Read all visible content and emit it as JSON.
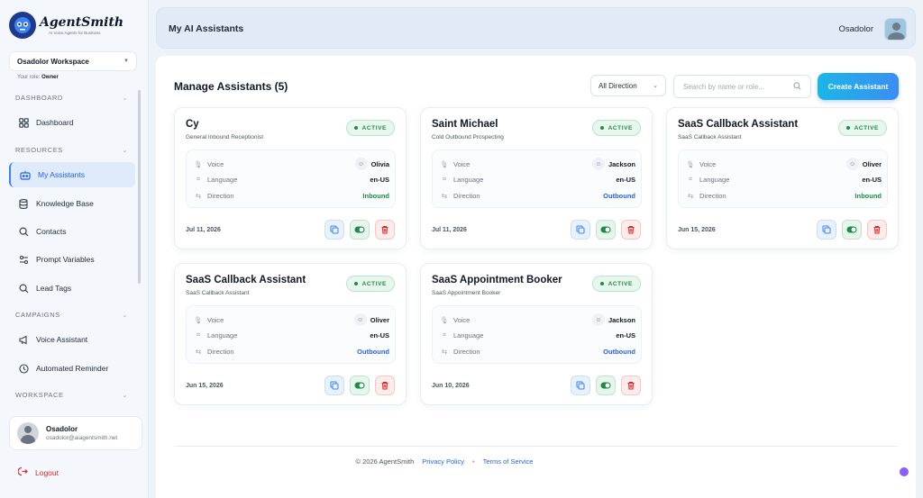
{
  "brand": {
    "name": "AgentSmith",
    "tagline": "AI Voice Agents for Business"
  },
  "sidebar": {
    "workspace": "Osadolor Workspace",
    "role_label": "Your role:",
    "role_value": "Owner",
    "sections": {
      "dashboard": "DASHBOARD",
      "resources": "RESOURCES",
      "campaigns": "CAMPAIGNS",
      "workspace": "WORKSPACE"
    },
    "items": {
      "dashboard": "Dashboard",
      "my_assistants": "My Assistants",
      "knowledge_base": "Knowledge Base",
      "contacts": "Contacts",
      "prompt_variables": "Prompt Variables",
      "lead_tags": "Lead Tags",
      "voice_assistant": "Voice Assistant",
      "automated_reminder": "Automated Reminder"
    },
    "user": {
      "name": "Osadolor",
      "email": "osadolor@aiagentsmith.net"
    },
    "logout": "Logout"
  },
  "header": {
    "title": "My AI Assistants",
    "user": "Osadolor"
  },
  "main": {
    "title": "Manage Assistants (5)",
    "direction_filter": "All Direction",
    "search_placeholder": "Search by name or role...",
    "create_button": "Create Assistant"
  },
  "labels": {
    "voice": "Voice",
    "language": "Language",
    "direction": "Direction"
  },
  "assistants": [
    {
      "name": "Cy",
      "role": "General Inbound Receptionist",
      "status": "ACTIVE",
      "voice": "Olivia",
      "language": "en-US",
      "direction": "Inbound",
      "date": "Jul 11, 2026"
    },
    {
      "name": "Saint Michael",
      "role": "Cold Outbound Prospecting",
      "status": "ACTIVE",
      "voice": "Jackson",
      "language": "en-US",
      "direction": "Outbound",
      "date": "Jul 11, 2026"
    },
    {
      "name": "SaaS Callback Assistant",
      "role": "SaaS Callback Assistant",
      "status": "ACTIVE",
      "voice": "Oliver",
      "language": "en-US",
      "direction": "Inbound",
      "date": "Jun 15, 2026"
    },
    {
      "name": "SaaS Callback Assistant",
      "role": "SaaS Callback Assistant",
      "status": "ACTIVE",
      "voice": "Oliver",
      "language": "en-US",
      "direction": "Outbound",
      "date": "Jun 15, 2026"
    },
    {
      "name": "SaaS Appointment Booker",
      "role": "SaaS Appointment Booker",
      "status": "ACTIVE",
      "voice": "Jackson",
      "language": "en-US",
      "direction": "Outbound",
      "date": "Jun 10, 2026"
    }
  ],
  "footer": {
    "copyright": "© 2026 AgentSmith",
    "privacy": "Privacy Policy",
    "separator": "•",
    "terms": "Terms of Service"
  },
  "colors": {
    "accent": "#2563eb",
    "active": "#1e8a4a",
    "danger": "#dc2626",
    "cta_start": "#1bb6e8",
    "cta_end": "#3b8ef3"
  }
}
